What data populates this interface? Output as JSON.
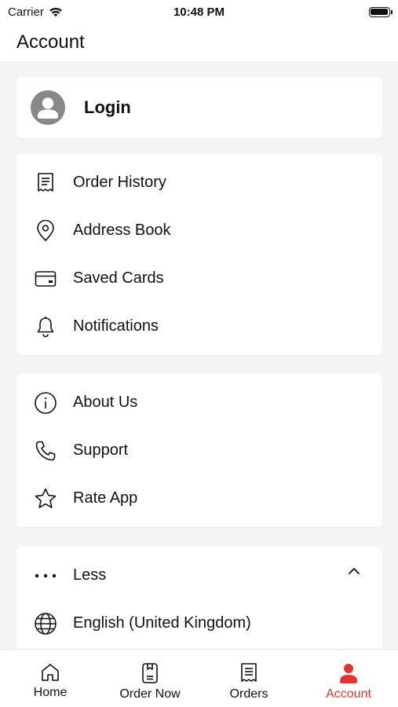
{
  "status_bar": {
    "carrier": "Carrier",
    "time": "10:48 PM"
  },
  "header": {
    "title": "Account"
  },
  "login": {
    "label": "Login"
  },
  "groups": {
    "primary": [
      {
        "label": "Order History",
        "icon": "receipt-icon"
      },
      {
        "label": "Address Book",
        "icon": "location-pin-icon"
      },
      {
        "label": "Saved Cards",
        "icon": "credit-card-icon"
      },
      {
        "label": "Notifications",
        "icon": "bell-icon"
      }
    ],
    "info": [
      {
        "label": "About Us",
        "icon": "info-icon"
      },
      {
        "label": "Support",
        "icon": "phone-icon"
      },
      {
        "label": "Rate App",
        "icon": "star-icon"
      }
    ],
    "more": [
      {
        "label": "Less",
        "icon": "more-dots-icon"
      },
      {
        "label": "English (United Kingdom)",
        "icon": "globe-icon"
      }
    ]
  },
  "tabbar": {
    "items": [
      {
        "label": "Home",
        "icon": "home-icon"
      },
      {
        "label": "Order Now",
        "icon": "order-now-icon"
      },
      {
        "label": "Orders",
        "icon": "orders-icon"
      },
      {
        "label": "Account",
        "icon": "account-icon",
        "active": true
      }
    ]
  },
  "colors": {
    "accent": "#e63329",
    "background": "#f5f5f5",
    "card": "#ffffff",
    "avatar": "#888888"
  }
}
